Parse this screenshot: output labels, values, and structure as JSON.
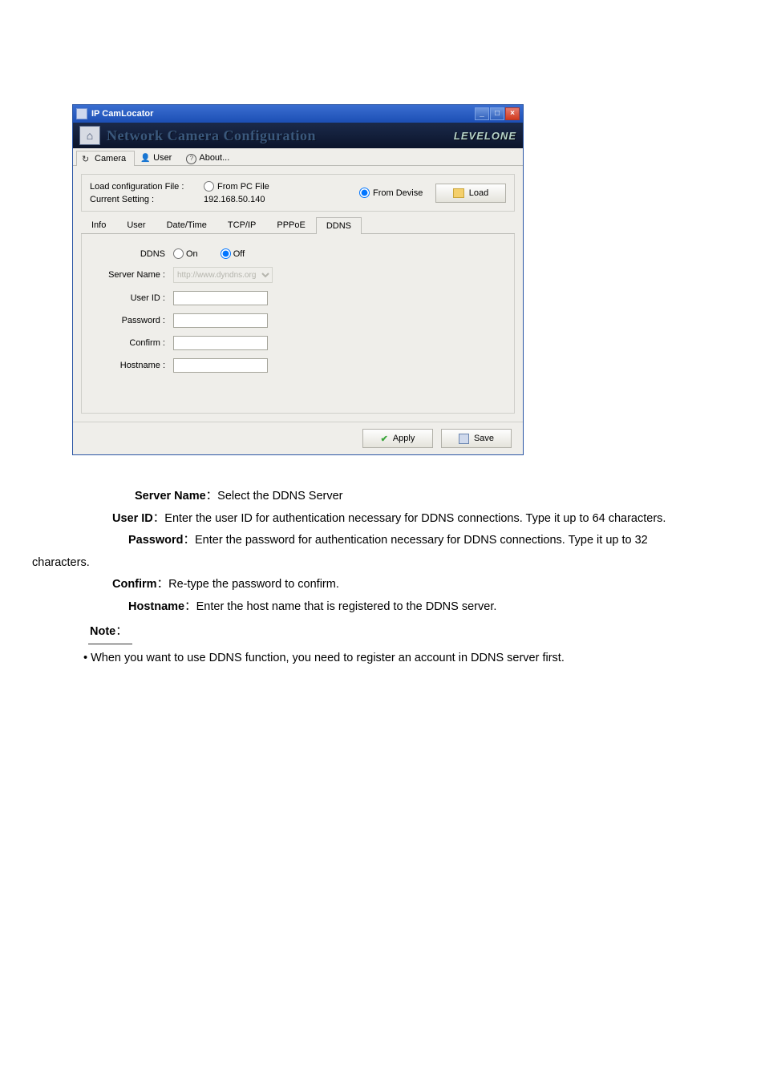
{
  "window": {
    "title": "IP CamLocator",
    "minimize": "_",
    "maximize": "□",
    "close": "×"
  },
  "banner": {
    "logo_glyph": "⌂",
    "title": "Network Camera Configuration",
    "brand": "LEVELONE"
  },
  "main_tabs": {
    "camera": "Camera",
    "user": "User",
    "about": "About..."
  },
  "load_area": {
    "label_file": "Load configuration File :",
    "label_setting": "Current Setting :",
    "from_pc": "From PC File",
    "from_device": "From Devise",
    "current_ip": "192.168.50.140",
    "load_btn": "Load"
  },
  "sub_tabs": {
    "info": "Info",
    "user": "User",
    "datetime": "Date/Time",
    "tcpip": "TCP/IP",
    "pppoe": "PPPoE",
    "ddns": "DDNS"
  },
  "ddns_form": {
    "ddns_label": "DDNS",
    "on": "On",
    "off": "Off",
    "server_name_label": "Server Name :",
    "server_name_value": "http://www.dyndns.org",
    "user_id_label": "User ID :",
    "password_label": "Password :",
    "confirm_label": "Confirm :",
    "hostname_label": "Hostname :"
  },
  "actions": {
    "apply": "Apply",
    "save": "Save"
  },
  "doc": {
    "server_name_b": "Server Name",
    "server_name_t": "：Select the DDNS Server",
    "user_id_b": "User ID",
    "user_id_t": "：Enter the user ID for authentication necessary for DDNS connections. Type it up to 64 characters.",
    "password_b": "Password",
    "password_t": "：Enter the password for authentication necessary for DDNS connections. Type it up to 32",
    "password_tail": "characters.",
    "confirm_b": "Confirm",
    "confirm_t": "：Re-type the password to confirm.",
    "hostname_b": "Hostname",
    "hostname_t": "：Enter the host name that is registered to the DDNS server.",
    "note_b": "Note",
    "note_colon": "：",
    "note_item": "• When you want to use DDNS function, you need to register an account in DDNS server first."
  }
}
